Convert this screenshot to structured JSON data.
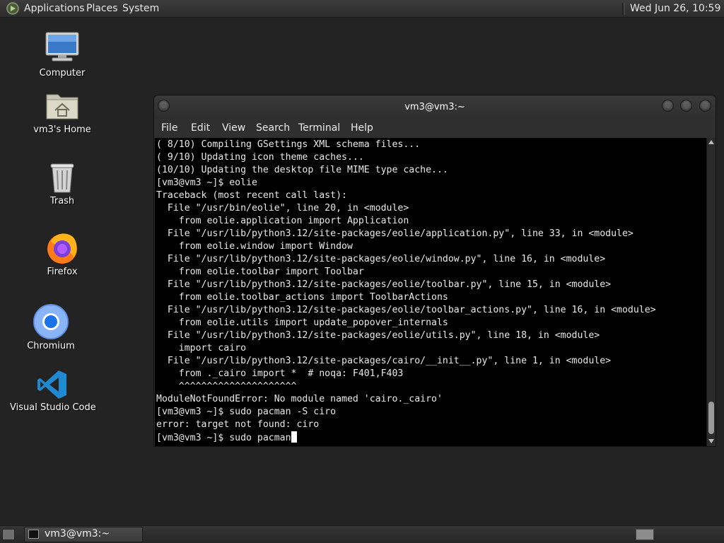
{
  "top_panel": {
    "menus": [
      "Applications",
      "Places",
      "System"
    ],
    "clock": "Wed Jun 26, 10:59 AM"
  },
  "desktop": {
    "icons": [
      {
        "label": "Computer",
        "icon": "computer-icon"
      },
      {
        "label": "vm3's Home",
        "icon": "home-folder-icon"
      },
      {
        "label": "Trash",
        "icon": "trash-icon"
      },
      {
        "label": "Firefox",
        "icon": "firefox-icon"
      },
      {
        "label": "Chromium",
        "icon": "chromium-icon"
      },
      {
        "label": "Visual Studio Code",
        "icon": "vscode-icon"
      }
    ]
  },
  "terminal": {
    "title": "vm3@vm3:~",
    "menu": [
      "File",
      "Edit",
      "View",
      "Search",
      "Terminal",
      "Help"
    ],
    "lines": [
      "( 8/10) Compiling GSettings XML schema files...",
      "( 9/10) Updating icon theme caches...",
      "(10/10) Updating the desktop file MIME type cache...",
      "[vm3@vm3 ~]$ eolie",
      "Traceback (most recent call last):",
      "  File \"/usr/bin/eolie\", line 20, in <module>",
      "    from eolie.application import Application",
      "  File \"/usr/lib/python3.12/site-packages/eolie/application.py\", line 33, in <module>",
      "    from eolie.window import Window",
      "  File \"/usr/lib/python3.12/site-packages/eolie/window.py\", line 16, in <module>",
      "    from eolie.toolbar import Toolbar",
      "  File \"/usr/lib/python3.12/site-packages/eolie/toolbar.py\", line 15, in <module>",
      "    from eolie.toolbar_actions import ToolbarActions",
      "  File \"/usr/lib/python3.12/site-packages/eolie/toolbar_actions.py\", line 16, in <module>",
      "    from eolie.utils import update_popover_internals",
      "  File \"/usr/lib/python3.12/site-packages/eolie/utils.py\", line 18, in <module>",
      "    import cairo",
      "  File \"/usr/lib/python3.12/site-packages/cairo/__init__.py\", line 1, in <module>",
      "    from ._cairo import *  # noqa: F401,F403",
      "    ^^^^^^^^^^^^^^^^^^^^^",
      "ModuleNotFoundError: No module named 'cairo._cairo'",
      "[vm3@vm3 ~]$ sudo pacman -S ciro",
      "error: target not found: ciro"
    ],
    "prompt_line": "[vm3@vm3 ~]$ sudo pacman"
  },
  "taskbar": {
    "task_label": "vm3@vm3:~"
  }
}
